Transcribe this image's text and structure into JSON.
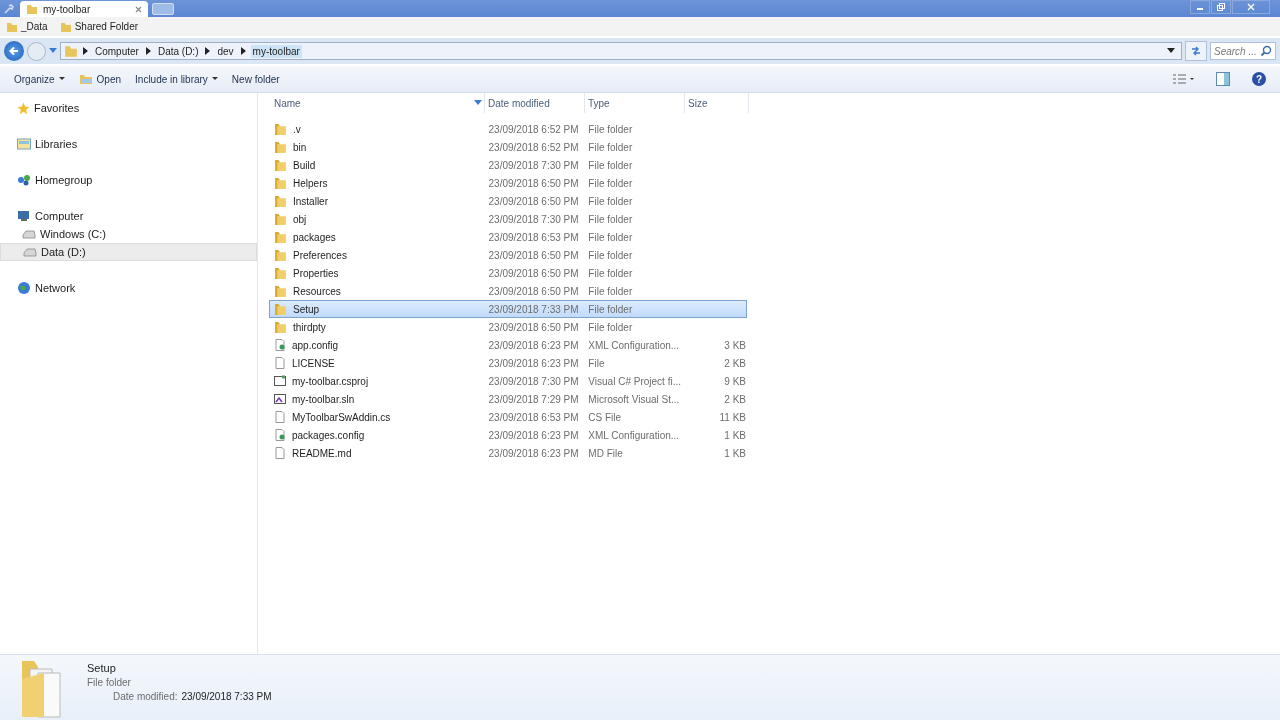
{
  "tab": {
    "title": "my-toolbar"
  },
  "bookmarks": [
    "_Data",
    "Shared Folder"
  ],
  "breadcrumb": [
    {
      "label": "Computer",
      "current": false
    },
    {
      "label": "Data (D:)",
      "current": false
    },
    {
      "label": "dev",
      "current": false
    },
    {
      "label": "my-toolbar",
      "current": true
    }
  ],
  "search": {
    "placeholder": "Search ..."
  },
  "toolbar": [
    {
      "label": "Organize",
      "kind": "menu"
    },
    {
      "label": "Open",
      "kind": "icon"
    },
    {
      "label": "Include in library",
      "kind": "menu"
    },
    {
      "label": "New folder",
      "kind": "plain"
    }
  ],
  "sidebar": {
    "items": [
      {
        "label": "Favorites",
        "kind": "star",
        "selected": false
      },
      {
        "label": "Libraries",
        "kind": "library",
        "selected": false
      },
      {
        "label": "Homegroup",
        "kind": "homegroup",
        "selected": false
      },
      {
        "label": "Computer",
        "kind": "computer",
        "selected": false,
        "children": [
          {
            "label": "Windows (C:)",
            "kind": "drive",
            "selected": false
          },
          {
            "label": "Data (D:)",
            "kind": "drive",
            "selected": true
          }
        ]
      },
      {
        "label": "Network",
        "kind": "network",
        "selected": false
      }
    ]
  },
  "help": {
    "label": "?"
  },
  "table": {
    "columns": [
      "Name",
      "Date modified",
      "Type",
      "Size"
    ],
    "rows": [
      {
        "name": ".v",
        "date": "23/09/2018 6:52 PM",
        "type": "File folder",
        "size": "",
        "kind": "folder",
        "selected": false
      },
      {
        "name": "bin",
        "date": "23/09/2018 6:52 PM",
        "type": "File folder",
        "size": "",
        "kind": "folder",
        "selected": false
      },
      {
        "name": "Build",
        "date": "23/09/2018 7:30 PM",
        "type": "File folder",
        "size": "",
        "kind": "folder",
        "selected": false
      },
      {
        "name": "Helpers",
        "date": "23/09/2018 6:50 PM",
        "type": "File folder",
        "size": "",
        "kind": "folder",
        "selected": false
      },
      {
        "name": "Installer",
        "date": "23/09/2018 6:50 PM",
        "type": "File folder",
        "size": "",
        "kind": "folder",
        "selected": false
      },
      {
        "name": "obj",
        "date": "23/09/2018 7:30 PM",
        "type": "File folder",
        "size": "",
        "kind": "folder",
        "selected": false
      },
      {
        "name": "packages",
        "date": "23/09/2018 6:53 PM",
        "type": "File folder",
        "size": "",
        "kind": "folder",
        "selected": false
      },
      {
        "name": "Preferences",
        "date": "23/09/2018 6:50 PM",
        "type": "File folder",
        "size": "",
        "kind": "folder",
        "selected": false
      },
      {
        "name": "Properties",
        "date": "23/09/2018 6:50 PM",
        "type": "File folder",
        "size": "",
        "kind": "folder",
        "selected": false
      },
      {
        "name": "Resources",
        "date": "23/09/2018 6:50 PM",
        "type": "File folder",
        "size": "",
        "kind": "folder",
        "selected": false
      },
      {
        "name": "Setup",
        "date": "23/09/2018 7:33 PM",
        "type": "File folder",
        "size": "",
        "kind": "folder",
        "selected": true
      },
      {
        "name": "thirdpty",
        "date": "23/09/2018 6:50 PM",
        "type": "File folder",
        "size": "",
        "kind": "folder",
        "selected": false
      },
      {
        "name": "app.config",
        "date": "23/09/2018 6:23 PM",
        "type": "XML Configuration...",
        "size": "3 KB",
        "kind": "config",
        "selected": false
      },
      {
        "name": "LICENSE",
        "date": "23/09/2018 6:23 PM",
        "type": "File",
        "size": "2 KB",
        "kind": "file",
        "selected": false
      },
      {
        "name": "my-toolbar.csproj",
        "date": "23/09/2018 7:30 PM",
        "type": "Visual C# Project fi...",
        "size": "9 KB",
        "kind": "project",
        "selected": false
      },
      {
        "name": "my-toolbar.sln",
        "date": "23/09/2018 7:29 PM",
        "type": "Microsoft Visual St...",
        "size": "2 KB",
        "kind": "solution",
        "selected": false
      },
      {
        "name": "MyToolbarSwAddin.cs",
        "date": "23/09/2018 6:53 PM",
        "type": "CS File",
        "size": "11 KB",
        "kind": "file",
        "selected": false
      },
      {
        "name": "packages.config",
        "date": "23/09/2018 6:23 PM",
        "type": "XML Configuration...",
        "size": "1 KB",
        "kind": "config",
        "selected": false
      },
      {
        "name": "README.md",
        "date": "23/09/2018 6:23 PM",
        "type": "MD File",
        "size": "1 KB",
        "kind": "file",
        "selected": false
      }
    ]
  },
  "details": {
    "name": "Setup",
    "type": "File folder",
    "date_label": "Date modified:",
    "date": "23/09/2018 7:33 PM"
  }
}
